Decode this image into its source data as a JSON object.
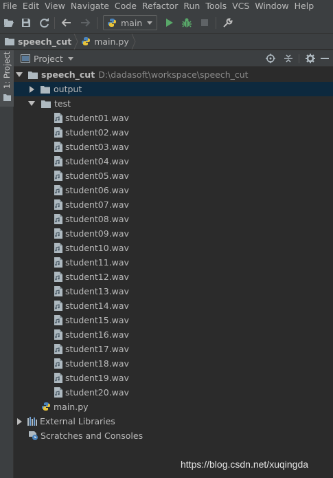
{
  "menu": [
    "File",
    "Edit",
    "View",
    "Navigate",
    "Code",
    "Refactor",
    "Run",
    "Tools",
    "VCS",
    "Window",
    "Help"
  ],
  "toolbar": {
    "run_config": "main",
    "icons": [
      "open-folder-icon",
      "save-icon",
      "sync-icon",
      "back-icon",
      "forward-icon",
      "run-icon",
      "debug-icon",
      "stop-icon",
      "wrench-icon"
    ]
  },
  "breadcrumb": {
    "project": "speech_cut",
    "file": "main.py"
  },
  "side_tab": {
    "label": "1: Project"
  },
  "panel": {
    "title": "Project"
  },
  "tree": {
    "root": {
      "name": "speech_cut",
      "path": "D:\\dadasoft\\workspace\\speech_cut"
    },
    "output": "output",
    "test": "test",
    "files": [
      "student01.wav",
      "student02.wav",
      "student03.wav",
      "student04.wav",
      "student05.wav",
      "student06.wav",
      "student07.wav",
      "student08.wav",
      "student09.wav",
      "student10.wav",
      "student11.wav",
      "student12.wav",
      "student13.wav",
      "student14.wav",
      "student15.wav",
      "student16.wav",
      "student17.wav",
      "student18.wav",
      "student19.wav",
      "student20.wav"
    ],
    "main_py": "main.py",
    "external_libraries": "External Libraries",
    "scratches": "Scratches and Consoles"
  },
  "watermark": "https://blog.csdn.net/xuqingda",
  "colors": {
    "background": "#2b2b2b",
    "chrome": "#3c3f41",
    "selection": "#0d293e",
    "run_green": "#59a869",
    "text": "#bbbbbb"
  }
}
